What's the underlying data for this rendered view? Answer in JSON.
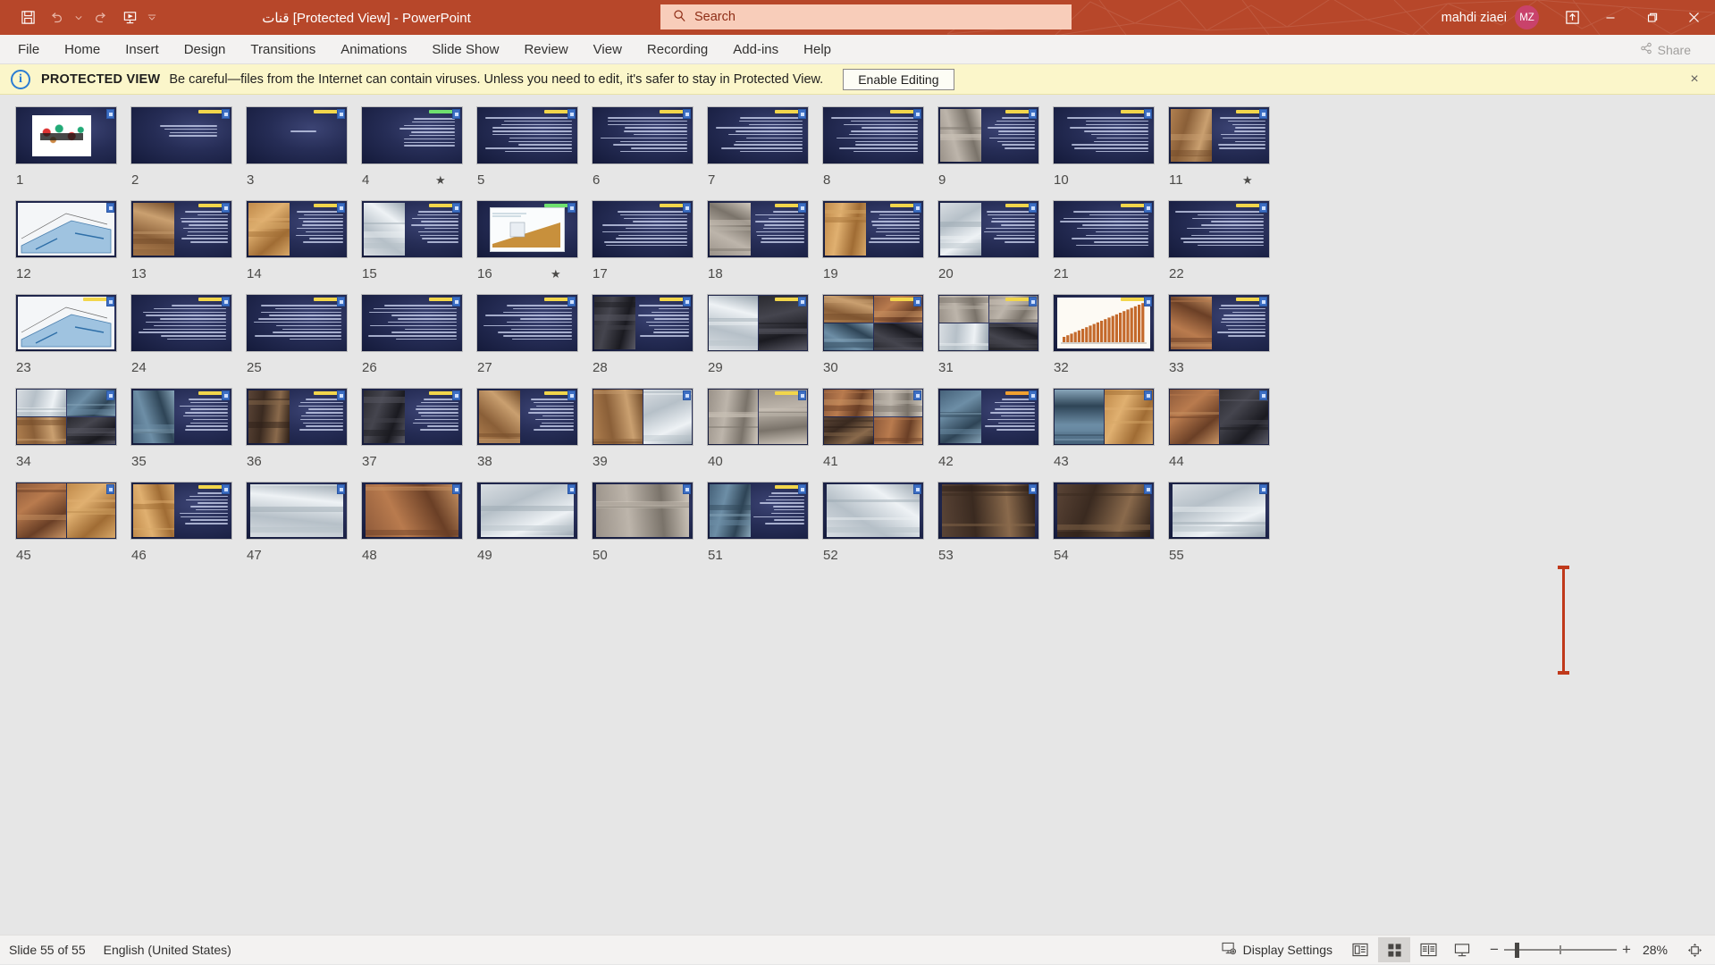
{
  "window": {
    "title": "قنات [Protected View]  -  PowerPoint",
    "accent_color": "#b7472a",
    "user_name": "mahdi ziaei",
    "avatar_initials": "MZ",
    "quick_access": [
      {
        "name": "save-icon",
        "label": "Save"
      },
      {
        "name": "undo-icon",
        "label": "Undo"
      },
      {
        "name": "undo-dropdown-icon",
        "label": "Undo options"
      },
      {
        "name": "redo-icon",
        "label": "Redo"
      },
      {
        "name": "start-presentation-icon",
        "label": "Start From Beginning"
      },
      {
        "name": "customize-quick-access-toolbar-icon",
        "label": "Customize Quick Access Toolbar"
      }
    ],
    "controls": {
      "ribbon_display_options": "Ribbon Display Options",
      "minimize": "Minimize",
      "restore": "Restore Down",
      "close": "Close"
    }
  },
  "search": {
    "placeholder": "Search",
    "icon": "search-icon"
  },
  "ribbon": {
    "tabs": [
      {
        "label": "File"
      },
      {
        "label": "Home"
      },
      {
        "label": "Insert"
      },
      {
        "label": "Design"
      },
      {
        "label": "Transitions"
      },
      {
        "label": "Animations"
      },
      {
        "label": "Slide Show"
      },
      {
        "label": "Review"
      },
      {
        "label": "View"
      },
      {
        "label": "Recording"
      },
      {
        "label": "Add-ins"
      },
      {
        "label": "Help"
      }
    ],
    "share_label": "Share"
  },
  "protected_view": {
    "icon": "info-icon",
    "title": "PROTECTED VIEW",
    "message": "Be careful—files from the Internet can contain viruses. Unless you need to edit, it's safer to stay in Protected View.",
    "enable_label": "Enable Editing",
    "close_label": "×"
  },
  "slides": [
    {
      "n": "1",
      "star": false,
      "style": "image-center",
      "title": null
    },
    {
      "n": "2",
      "star": false,
      "style": "title-lines",
      "title": "yellow"
    },
    {
      "n": "3",
      "star": false,
      "style": "title-only",
      "title": "yellow"
    },
    {
      "n": "4",
      "star": true,
      "style": "bullets",
      "title": "green"
    },
    {
      "n": "5",
      "star": false,
      "style": "text-dense",
      "title": "yellow"
    },
    {
      "n": "6",
      "star": false,
      "style": "text-dense",
      "title": "yellow"
    },
    {
      "n": "7",
      "star": false,
      "style": "text-dense",
      "title": "yellow"
    },
    {
      "n": "8",
      "star": false,
      "style": "text-dense",
      "title": "yellow"
    },
    {
      "n": "9",
      "star": false,
      "style": "photo-left",
      "title": "yellow"
    },
    {
      "n": "10",
      "star": false,
      "style": "text-dense",
      "title": "yellow"
    },
    {
      "n": "11",
      "star": true,
      "style": "photo-left",
      "title": "yellow"
    },
    {
      "n": "12",
      "star": false,
      "style": "diagram",
      "title": null
    },
    {
      "n": "13",
      "star": false,
      "style": "photo-left",
      "title": "yellow"
    },
    {
      "n": "14",
      "star": false,
      "style": "photo-left",
      "title": "yellow"
    },
    {
      "n": "15",
      "star": false,
      "style": "photo-left",
      "title": "yellow"
    },
    {
      "n": "16",
      "star": true,
      "style": "chart",
      "title": "green"
    },
    {
      "n": "17",
      "star": false,
      "style": "text-dense",
      "title": "yellow"
    },
    {
      "n": "18",
      "star": false,
      "style": "photo-left",
      "title": "yellow"
    },
    {
      "n": "19",
      "star": false,
      "style": "photo-left",
      "title": "yellow"
    },
    {
      "n": "20",
      "star": false,
      "style": "photo-left",
      "title": "yellow"
    },
    {
      "n": "21",
      "star": false,
      "style": "text-dense",
      "title": "yellow"
    },
    {
      "n": "22",
      "star": false,
      "style": "text-dense",
      "title": "yellow"
    },
    {
      "n": "23",
      "star": false,
      "style": "diagram",
      "title": "yellow"
    },
    {
      "n": "24",
      "star": false,
      "style": "text-dense",
      "title": "yellow"
    },
    {
      "n": "25",
      "star": false,
      "style": "text-dense",
      "title": "yellow"
    },
    {
      "n": "26",
      "star": false,
      "style": "text-dense",
      "title": "yellow"
    },
    {
      "n": "27",
      "star": false,
      "style": "text-dense",
      "title": "yellow"
    },
    {
      "n": "28",
      "star": false,
      "style": "photo-left",
      "title": "yellow"
    },
    {
      "n": "29",
      "star": false,
      "style": "photo-two",
      "title": "yellow"
    },
    {
      "n": "30",
      "star": false,
      "style": "photo-quad",
      "title": "yellow"
    },
    {
      "n": "31",
      "star": false,
      "style": "photo-quad",
      "title": "yellow"
    },
    {
      "n": "32",
      "star": false,
      "style": "bar-chart",
      "title": "yellow"
    },
    {
      "n": "33",
      "star": false,
      "style": "photo-left",
      "title": "yellow"
    },
    {
      "n": "34",
      "star": false,
      "style": "photo-quad",
      "title": null
    },
    {
      "n": "35",
      "star": false,
      "style": "photo-left",
      "title": "yellow"
    },
    {
      "n": "36",
      "star": false,
      "style": "photo-left",
      "title": "yellow"
    },
    {
      "n": "37",
      "star": false,
      "style": "photo-left",
      "title": "yellow"
    },
    {
      "n": "38",
      "star": false,
      "style": "photo-left",
      "title": "yellow"
    },
    {
      "n": "39",
      "star": false,
      "style": "photo-two",
      "title": null
    },
    {
      "n": "40",
      "star": false,
      "style": "photo-two",
      "title": "yellow"
    },
    {
      "n": "41",
      "star": false,
      "style": "photo-quad",
      "title": null
    },
    {
      "n": "42",
      "star": false,
      "style": "photo-left",
      "title": "orange"
    },
    {
      "n": "43",
      "star": false,
      "style": "photo-two",
      "title": null
    },
    {
      "n": "44",
      "star": false,
      "style": "photo-two",
      "title": null
    },
    {
      "n": "45",
      "star": false,
      "style": "photo-two",
      "title": null
    },
    {
      "n": "46",
      "star": false,
      "style": "photo-left",
      "title": "yellow"
    },
    {
      "n": "47",
      "star": false,
      "style": "photo-full",
      "title": null
    },
    {
      "n": "48",
      "star": false,
      "style": "photo-full",
      "title": null
    },
    {
      "n": "49",
      "star": false,
      "style": "photo-full",
      "title": null
    },
    {
      "n": "50",
      "star": false,
      "style": "photo-full",
      "title": null
    },
    {
      "n": "51",
      "star": false,
      "style": "photo-left",
      "title": "yellow"
    },
    {
      "n": "52",
      "star": false,
      "style": "photo-full",
      "title": null
    },
    {
      "n": "53",
      "star": false,
      "style": "photo-full",
      "title": null
    },
    {
      "n": "54",
      "star": false,
      "style": "photo-full",
      "title": null
    },
    {
      "n": "55",
      "star": false,
      "style": "photo-full",
      "title": null
    }
  ],
  "status_bar": {
    "slide_counter": "Slide 55 of 55",
    "language": "English (United States)",
    "display_settings": "Display Settings",
    "views": [
      {
        "name": "normal-view-button",
        "label": "Normal"
      },
      {
        "name": "slide-sorter-view-button",
        "label": "Slide Sorter",
        "active": true
      },
      {
        "name": "reading-view-button",
        "label": "Reading View"
      },
      {
        "name": "slide-show-button",
        "label": "Slide Show"
      }
    ],
    "zoom_out_label": "−",
    "zoom_in_label": "+",
    "zoom_level": "28%",
    "fit_to_window": "Fit slide to current window"
  }
}
